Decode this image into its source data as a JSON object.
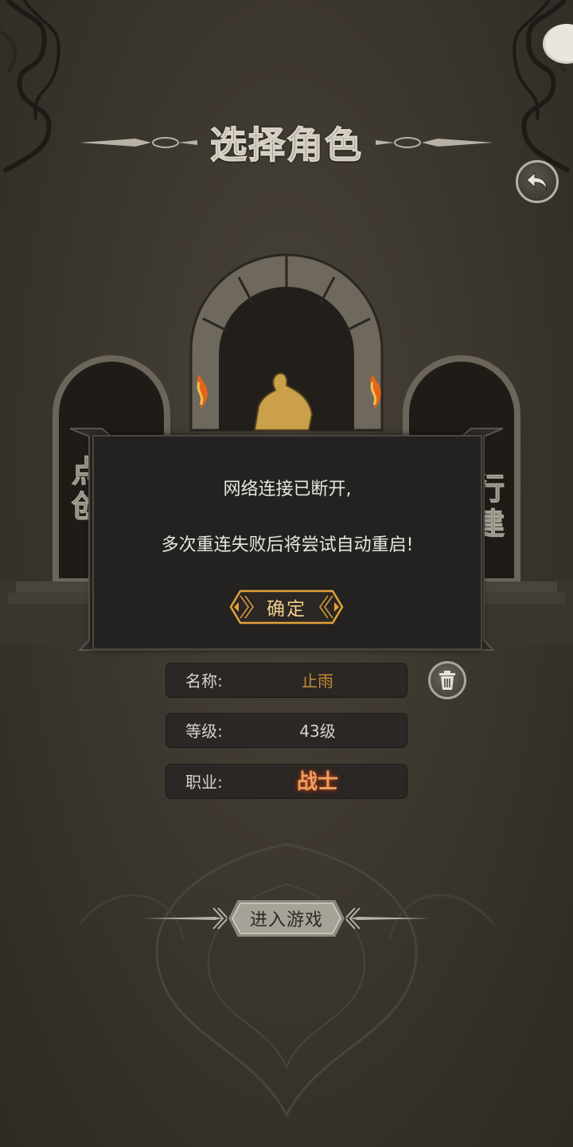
{
  "screen": {
    "title": "选择角色"
  },
  "side_labels": {
    "left": "点\n创",
    "right": "行\n建"
  },
  "dialog": {
    "line1": "网络连接已断开,",
    "line2": "多次重连失败后将尝试自动重启!",
    "confirm_label": "确定"
  },
  "character": {
    "rows": [
      {
        "key": "名称:",
        "value": "止雨"
      },
      {
        "key": "等级:",
        "value": "43级"
      },
      {
        "key": "职业:",
        "value": "战士"
      }
    ]
  },
  "enter_game_label": "进入游戏",
  "icons": {
    "back": "back-arrow-icon",
    "delete": "trash-icon"
  },
  "colors": {
    "background": "#3c372f",
    "dialog_bg": "#232220",
    "accent_gold": "#e4a23a",
    "name_color": "#c78a33",
    "job_color": "#e9a262"
  }
}
